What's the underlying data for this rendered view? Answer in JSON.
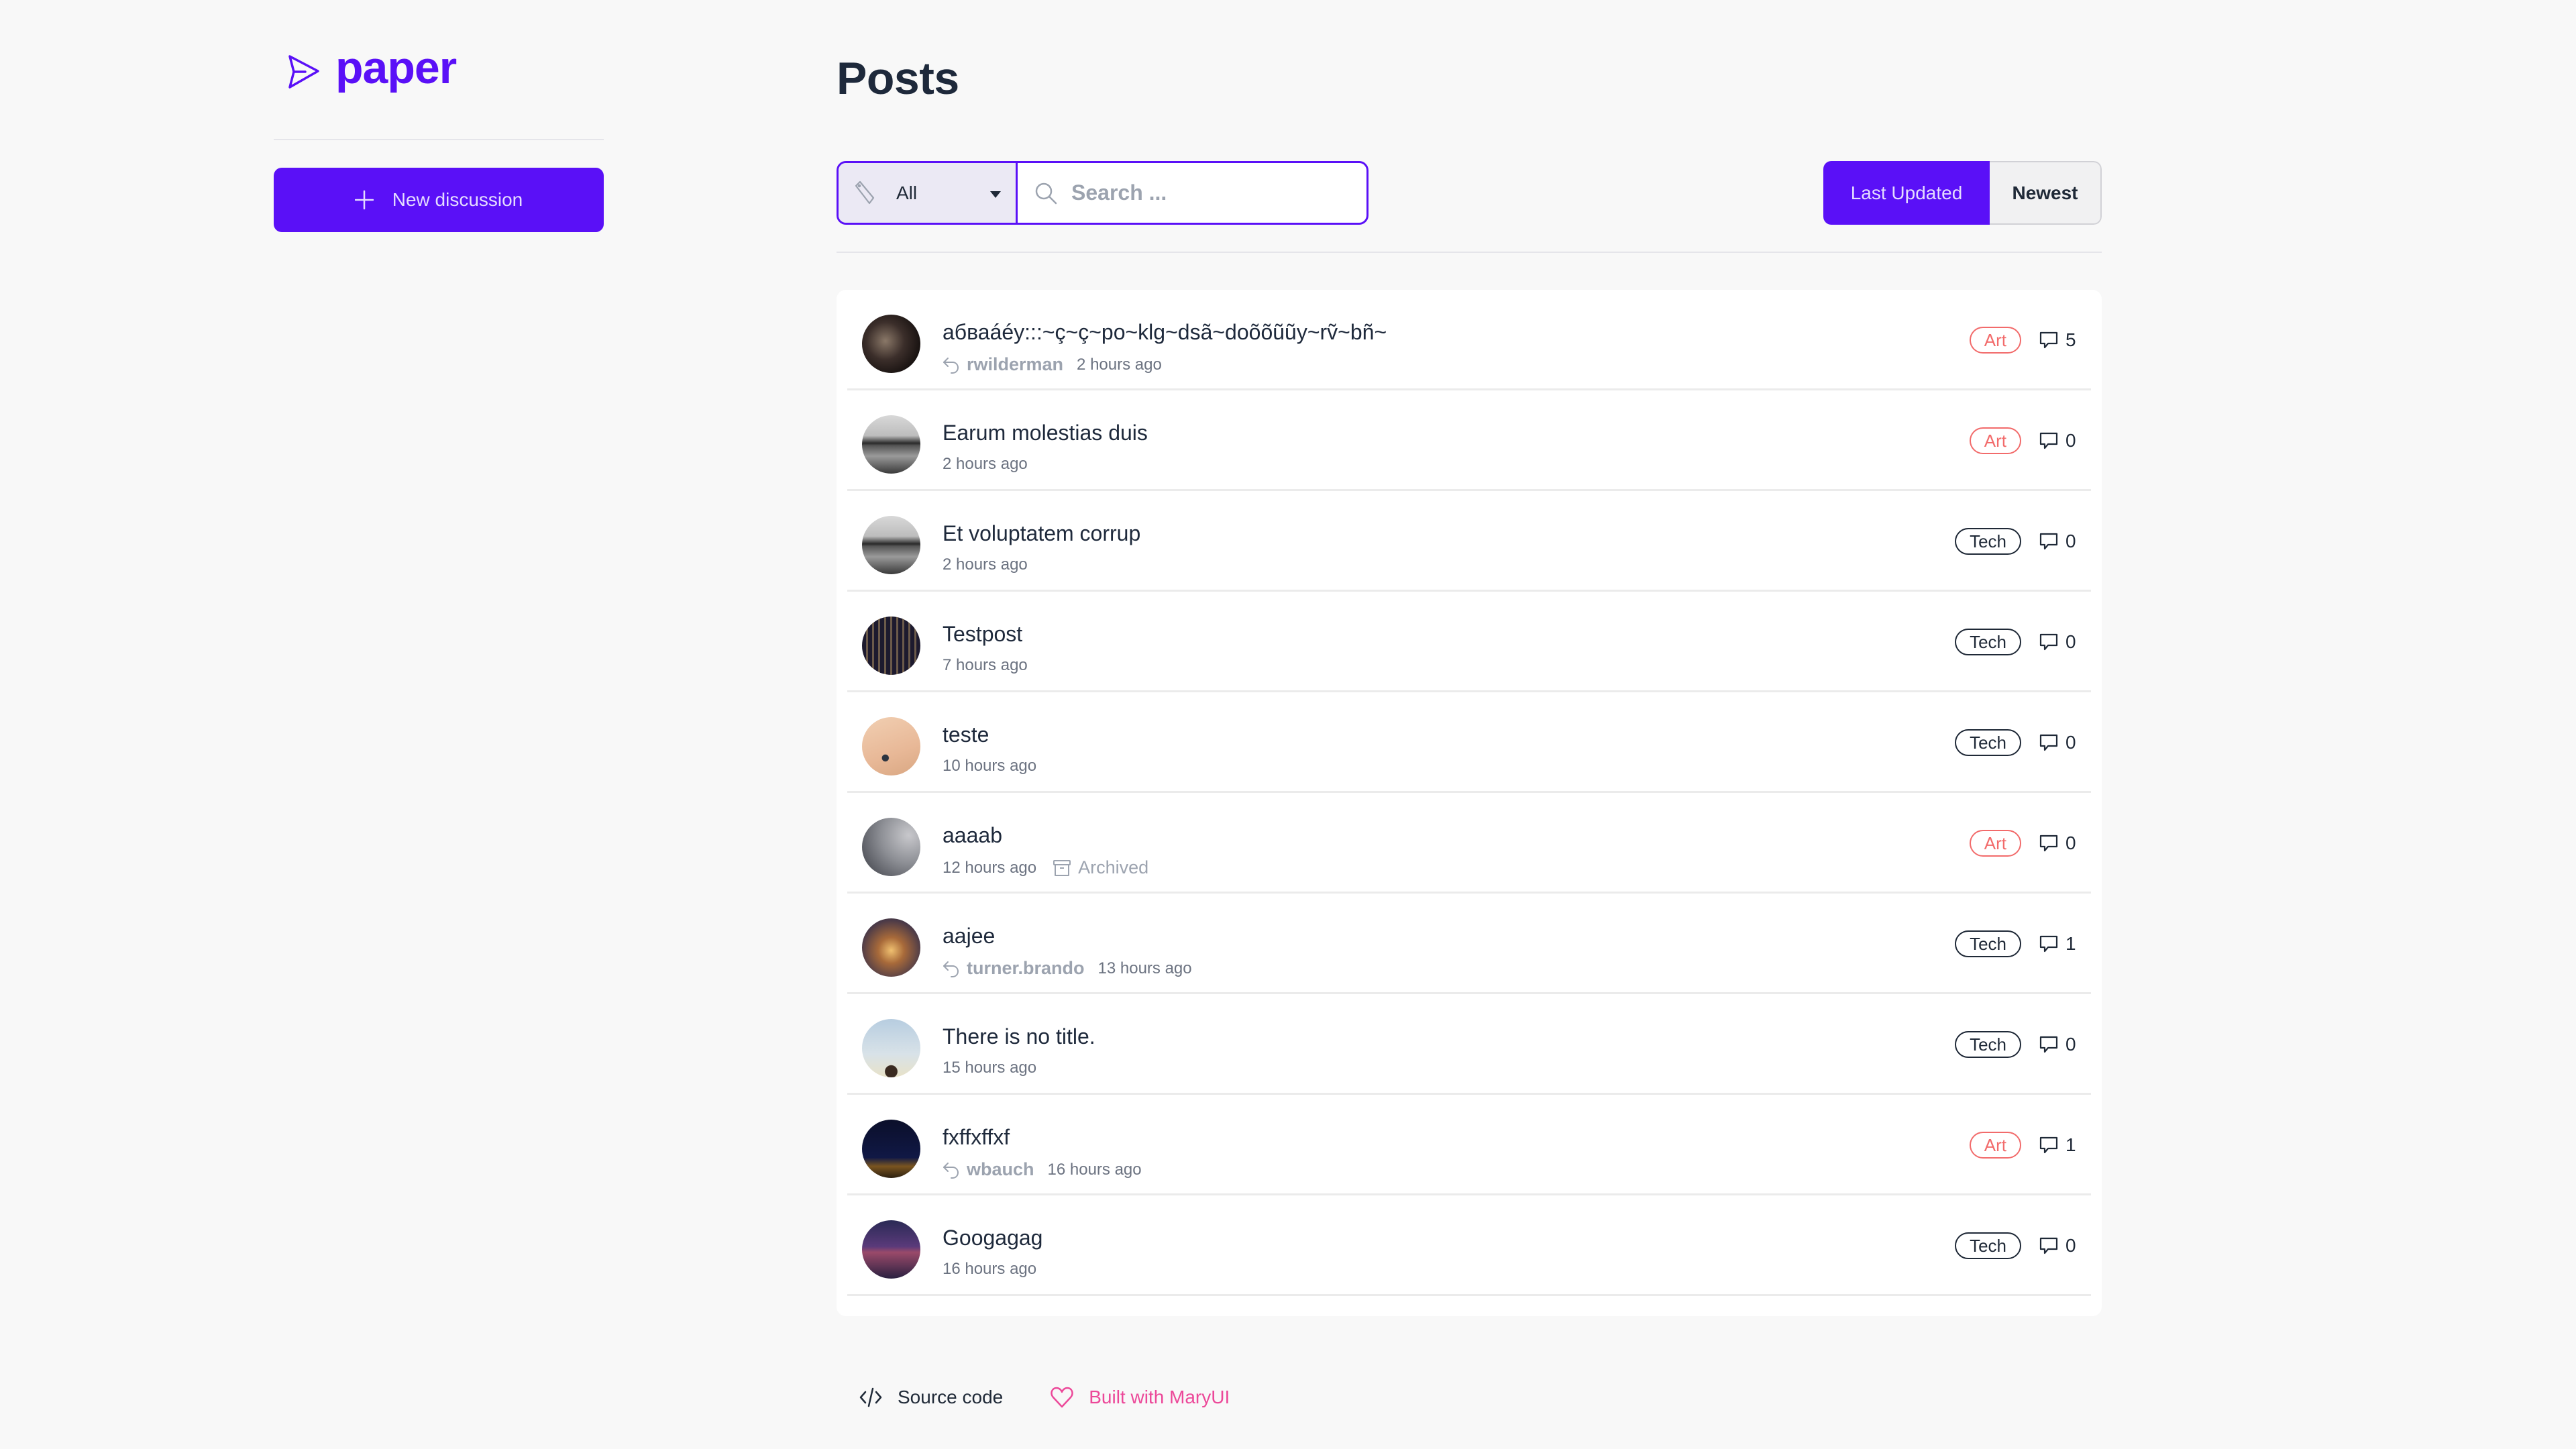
{
  "brand": {
    "name": "paper",
    "accent": "#5a10f7"
  },
  "sidebar": {
    "new_discussion_label": "New discussion"
  },
  "header": {
    "title": "Posts"
  },
  "filters": {
    "tag_select": {
      "selected": "All"
    },
    "search": {
      "placeholder": "Search ...",
      "value": ""
    }
  },
  "sort_tabs": [
    {
      "label": "Last Updated",
      "active": true
    },
    {
      "label": "Newest",
      "active": false
    }
  ],
  "posts": [
    {
      "title": "абваáéy:::~ç~ç~po~klg~dsã~doõõũũy~rṽ~bñ~",
      "reply_author": "rwilderman",
      "time": "2 hours ago",
      "archived": false,
      "tag": "Art",
      "comments": "5",
      "avatar": "dark-machinery"
    },
    {
      "title": "Earum molestias duis",
      "reply_author": null,
      "time": "2 hours ago",
      "archived": false,
      "tag": "Art",
      "comments": "0",
      "avatar": "bw-pier"
    },
    {
      "title": "Et voluptatem corrup",
      "reply_author": null,
      "time": "2 hours ago",
      "archived": false,
      "tag": "Tech",
      "comments": "0",
      "avatar": "bw-pier"
    },
    {
      "title": "Testpost",
      "reply_author": null,
      "time": "7 hours ago",
      "archived": false,
      "tag": "Tech",
      "comments": "0",
      "avatar": "building-windows"
    },
    {
      "title": "teste",
      "reply_author": null,
      "time": "10 hours ago",
      "archived": false,
      "tag": "Tech",
      "comments": "0",
      "avatar": "sand-stones"
    },
    {
      "title": "aaaab",
      "reply_author": null,
      "time": "12 hours ago",
      "archived": true,
      "archived_label": "Archived",
      "tag": "Art",
      "comments": "0",
      "avatar": "moon-surface"
    },
    {
      "title": "aajee",
      "reply_author": "turner.brando",
      "time": "13 hours ago",
      "archived": false,
      "tag": "Tech",
      "comments": "1",
      "avatar": "foggy-road"
    },
    {
      "title": "There is no title.",
      "reply_author": null,
      "time": "15 hours ago",
      "archived": false,
      "tag": "Tech",
      "comments": "0",
      "avatar": "man-sky"
    },
    {
      "title": "fxffxffxf",
      "reply_author": "wbauch",
      "time": "16 hours ago",
      "archived": false,
      "tag": "Art",
      "comments": "1",
      "avatar": "night-sky"
    },
    {
      "title": "Googagag",
      "reply_author": null,
      "time": "16 hours ago",
      "archived": false,
      "tag": "Tech",
      "comments": "0",
      "avatar": "bridge-night"
    }
  ],
  "footer": {
    "source_code_label": "Source code",
    "built_with_label": "Built with MaryUI"
  },
  "colors": {
    "art_badge": "#f26b6b",
    "tech_badge": "#1f2937",
    "footer_pink": "#ec4899"
  }
}
